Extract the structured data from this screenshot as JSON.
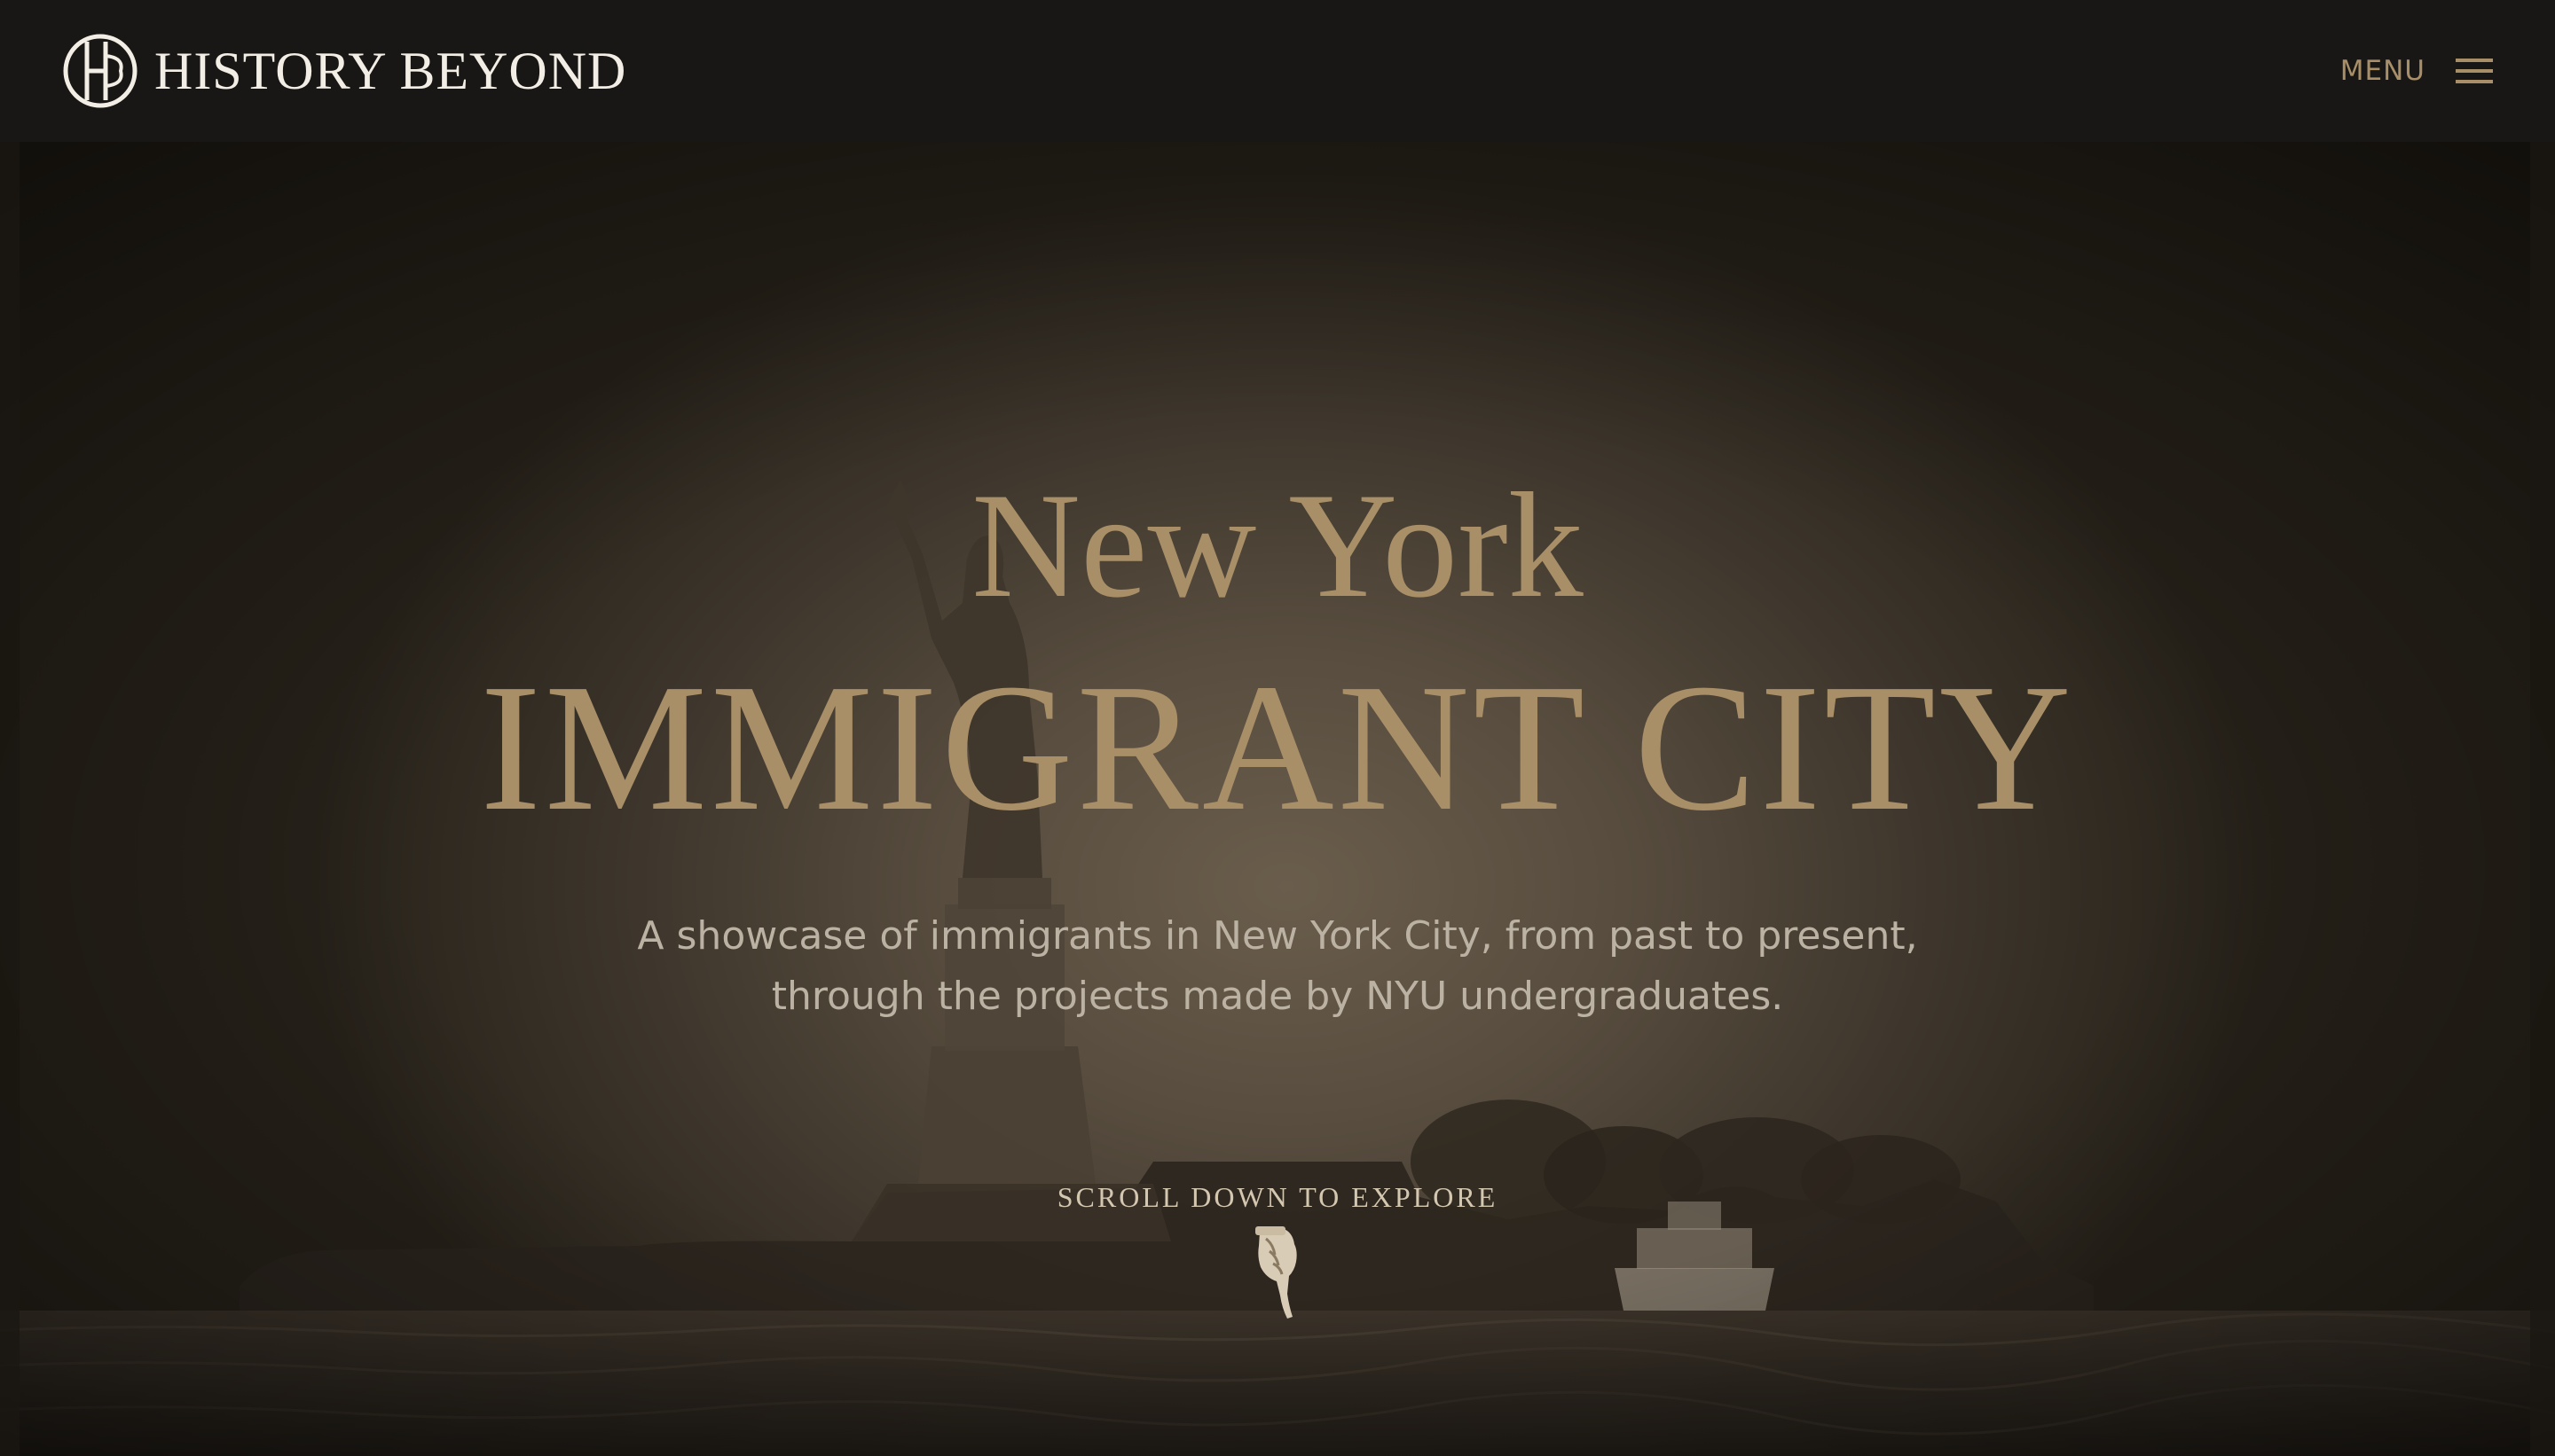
{
  "header": {
    "brand_name": "HISTORY BEYOND",
    "logo_icon": "hb-monogram-icon",
    "menu_label": "MENU",
    "menu_icon": "hamburger-icon"
  },
  "hero": {
    "kicker": "New York",
    "title": "IMMIGRANT CITY",
    "description_line1": "A showcase of immigrants in New York City, from past to present,",
    "description_line2": "through the projects made by NYU undergraduates.",
    "scroll_label": "SCROLL DOWN TO EXPLORE",
    "scroll_icon": "pointing-hand-down-icon",
    "background_image": "statue-of-liberty-sepia-photo"
  },
  "colors": {
    "header_bg": "#181715",
    "accent_gold": "#a88f68",
    "brand_text": "#f2eee6",
    "body_text": "#bcb2a3"
  }
}
